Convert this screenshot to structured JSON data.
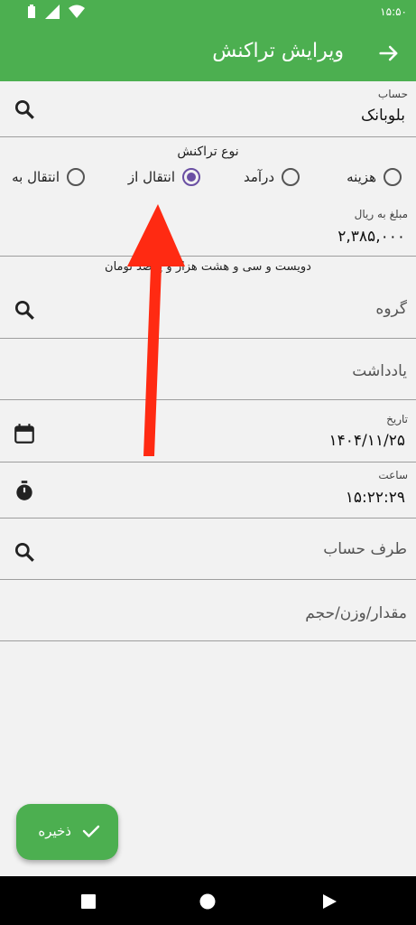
{
  "status_bar": {
    "time": "۱۵:۵۰"
  },
  "app_bar": {
    "title": "ویرایش تراکنش"
  },
  "account": {
    "label": "حساب",
    "value": "بلوبانک"
  },
  "transaction_type": {
    "title": "نوع تراکنش",
    "options": [
      {
        "label": "هزینه",
        "selected": false
      },
      {
        "label": "درآمد",
        "selected": false
      },
      {
        "label": "انتقال از",
        "selected": true
      },
      {
        "label": "انتقال به",
        "selected": false
      }
    ]
  },
  "amount": {
    "label": "مبلغ به ریال",
    "value": "۲,۳۸۵,۰۰۰",
    "words": "دویست و سی و هشت هزار و پانصد تومان"
  },
  "group": {
    "placeholder": "گروه"
  },
  "note": {
    "placeholder": "یادداشت"
  },
  "date": {
    "label": "تاریخ",
    "value": "۱۴۰۴/۱۱/۲۵"
  },
  "time": {
    "label": "ساعت",
    "value": "۱۵:۲۲:۲۹"
  },
  "counterparty": {
    "placeholder": "طرف حساب"
  },
  "quantity": {
    "placeholder": "مقدار/وزن/حجم"
  },
  "fab": {
    "label": "ذخیره"
  },
  "colors": {
    "primary": "#4caf50",
    "radio_selected": "#6a4fa3",
    "annotation_arrow": "#ff2a12"
  },
  "icons": [
    "battery-icon",
    "signal-icon",
    "wifi-icon",
    "back-arrow-icon",
    "search-icon",
    "calendar-icon",
    "timer-icon",
    "check-icon",
    "nav-recents-icon",
    "nav-home-icon",
    "nav-back-icon"
  ]
}
